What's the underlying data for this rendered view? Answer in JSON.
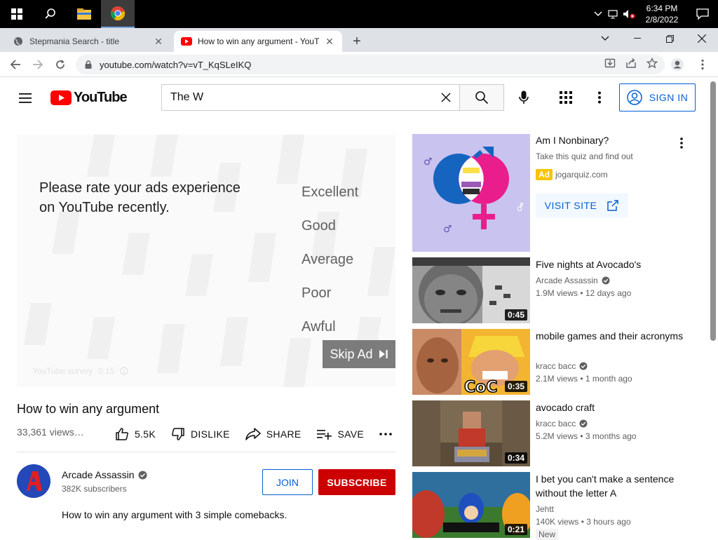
{
  "taskbar": {
    "clock_time": "6:34 PM",
    "clock_date": "2/8/2022"
  },
  "browser": {
    "tabs": [
      {
        "label": "Stepmania Search - title"
      },
      {
        "label": "How to win any argument - YouT"
      }
    ],
    "url": "youtube.com/watch?v=vT_KqSLeIKQ"
  },
  "youtube": {
    "logo_text": "YouTube",
    "search_value": "The W",
    "sign_in_label": "SIGN IN"
  },
  "ad_survey": {
    "question": "Please rate your ads experience on YouTube recently.",
    "options": [
      "Excellent",
      "Good",
      "Average",
      "Poor",
      "Awful"
    ],
    "skip_label": "Skip Ad",
    "survey_label": "YouTube survey",
    "survey_counter": "0:15"
  },
  "video": {
    "title": "How to win any argument",
    "views": "33,361 views…",
    "like_count": "5.5K",
    "dislike_label": "DISLIKE",
    "share_label": "SHARE",
    "save_label": "SAVE",
    "channel_name": "Arcade Assassin",
    "subscribers": "382K subscribers",
    "join_label": "JOIN",
    "subscribe_label": "SUBSCRIBE",
    "description": "How to win any argument with 3 simple comebacks."
  },
  "sidebar_ad": {
    "title": "Am I Nonbinary?",
    "subtitle": "Take this quiz and find out",
    "badge": "Ad",
    "domain": "jogarquiz.com",
    "cta": "VISIT SITE"
  },
  "recommendations": [
    {
      "title": "Five nights at Avocado's",
      "channel": "Arcade Assassin",
      "meta": "1.9M views • 12 days ago",
      "duration": "0:45"
    },
    {
      "title": "mobile games and their acronyms",
      "channel": "kracc bacc",
      "meta": "2.1M views • 1 month ago",
      "duration": "0:35",
      "thumb_text": "CoC"
    },
    {
      "title": "avocado craft",
      "channel": "kracc bacc",
      "meta": "5.2M views • 3 months ago",
      "duration": "0:34"
    },
    {
      "title": "I bet you can't make a sentence without the letter A",
      "channel": "Jehtt",
      "meta": "140K views • 3 hours ago",
      "duration": "0:21",
      "badge": "New"
    }
  ],
  "colors": {
    "youtube_red": "#ff0000",
    "subscribe_red": "#cc0000",
    "link_blue": "#065fd4",
    "ad_yellow": "#f9c300"
  }
}
